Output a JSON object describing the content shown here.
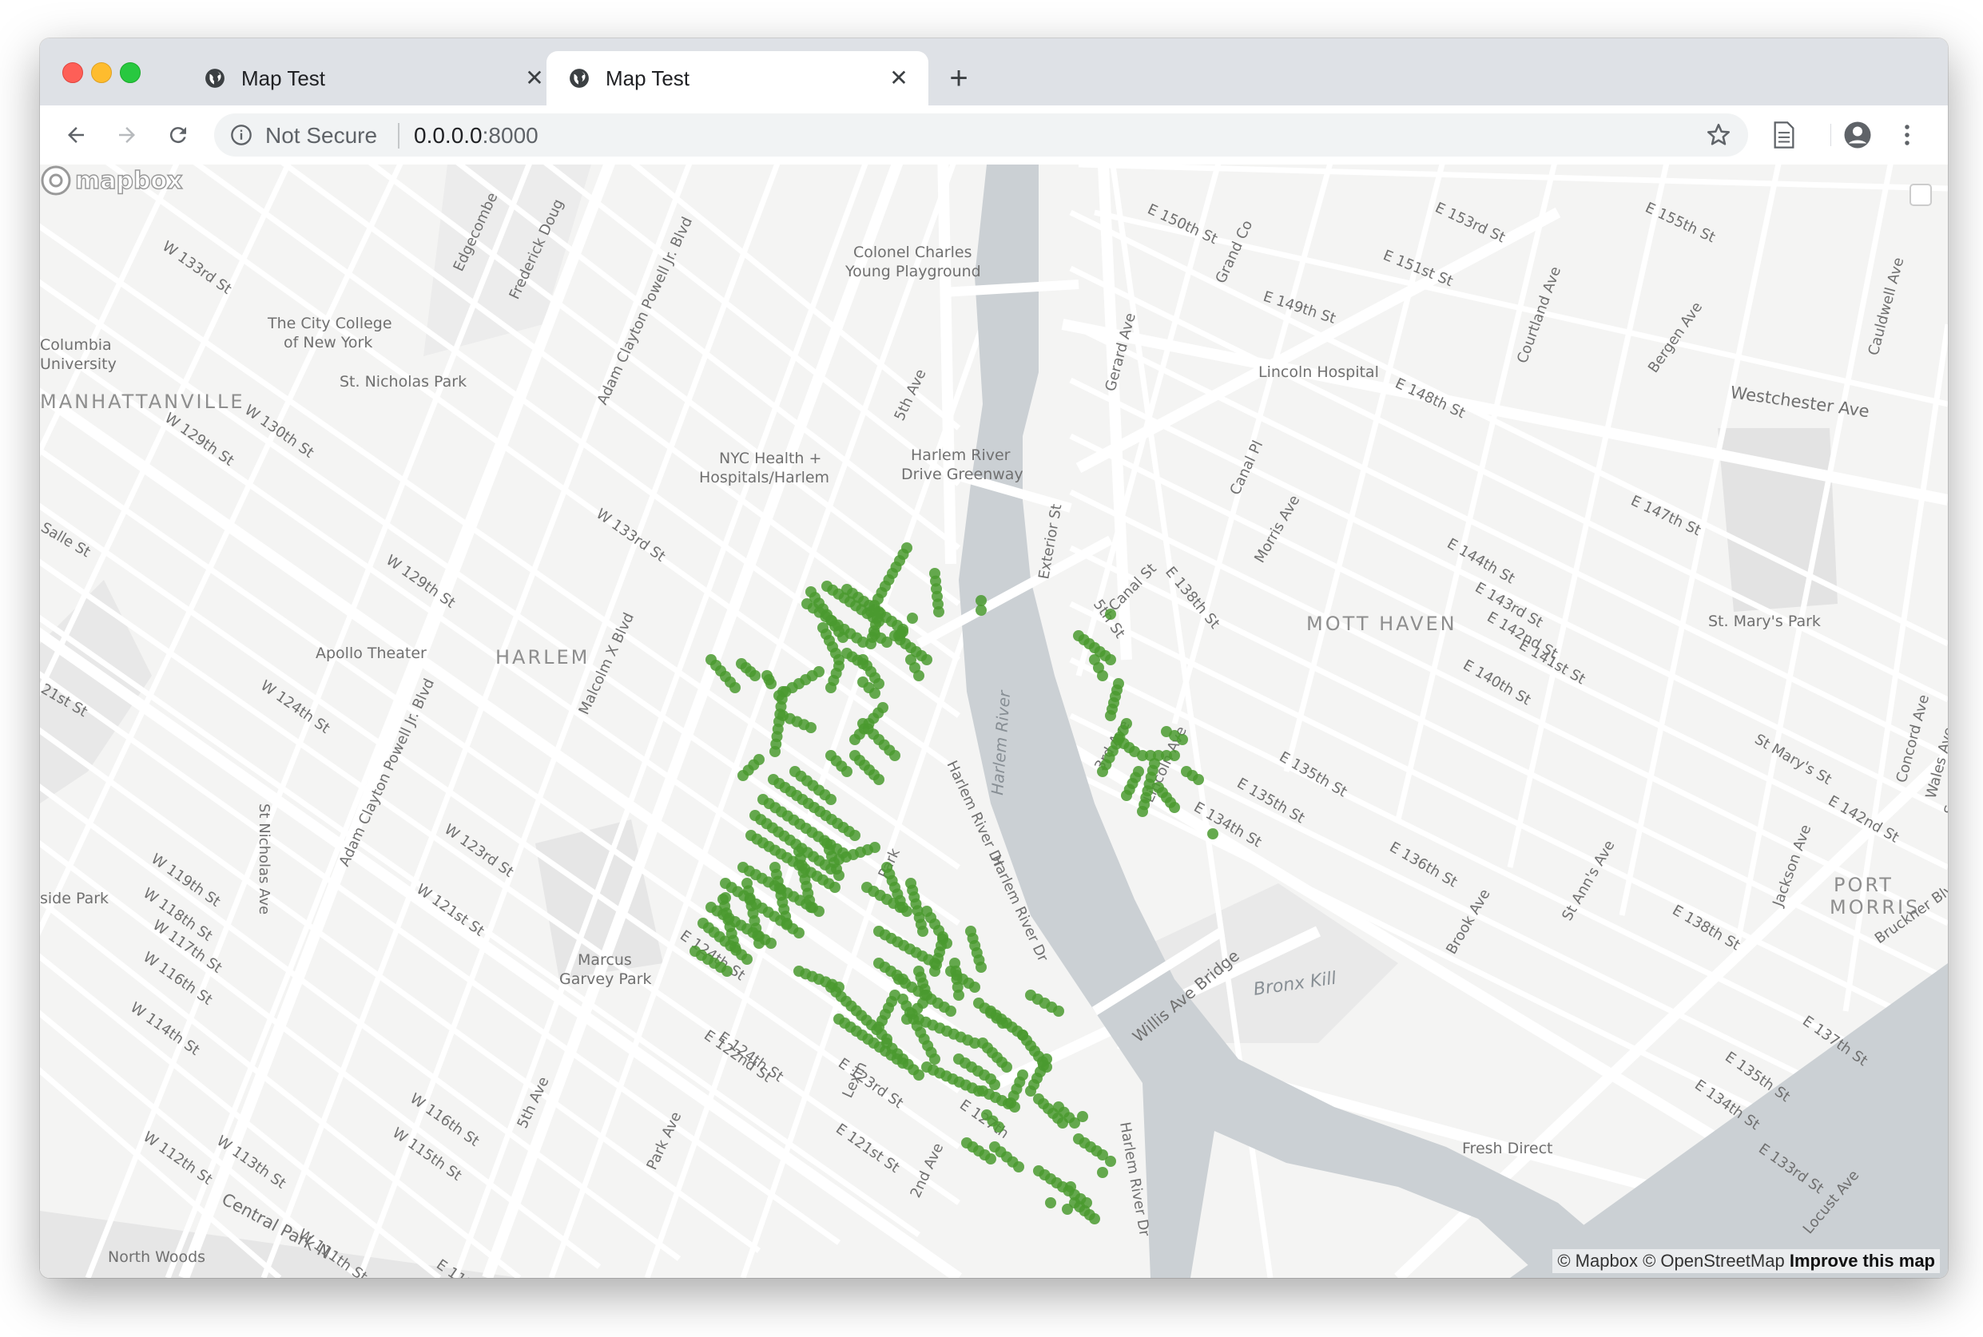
{
  "browser": {
    "tabs": [
      {
        "title": "Map Test",
        "active": false
      },
      {
        "title": "Map Test",
        "active": true
      }
    ],
    "new_tab_label": "+",
    "security_label": "Not Secure",
    "url_host": "0.0.0.0",
    "url_port": ":8000"
  },
  "map": {
    "attribution_mapbox": "© Mapbox",
    "attribution_osm": "© OpenStreetMap",
    "attribution_improve": "Improve this map",
    "logo_text": "mapbox",
    "point_color": "#4a9a2f",
    "area_labels": [
      "MANHATTANVILLE",
      "HARLEM",
      "MOTT HAVEN",
      "PORT",
      "MORRIS"
    ],
    "water_labels": [
      "Harlem River",
      "Bronx Kill"
    ],
    "place_labels": [
      "Columbia",
      "University",
      "The City College",
      "of New York",
      "St. Nicholas Park",
      "Colonel Charles",
      "Young Playground",
      "NYC Health +",
      "Hospitals/Harlem",
      "Harlem River",
      "Drive Greenway",
      "Lincoln Hospital",
      "Apollo Theater",
      "St. Mary's Park",
      "Marcus",
      "Garvey Park",
      "Fresh Direct",
      "side Park",
      "North Woods"
    ],
    "street_labels": [
      "W 133rd St",
      "Edgecombe",
      "Frederick Doug",
      "Adam Clayton Powell Jr. Blvd",
      "W 129th St",
      "W 130th St",
      "Salle St",
      "W 129th St",
      "W 133rd St",
      "5th Ave",
      "E 150th St",
      "Grand Co",
      "E 153rd St",
      "E 155th St",
      "E 151st St",
      "E 149th St",
      "Courtland Ave",
      "Gerard Ave",
      "E 148th St",
      "Bergen Ave",
      "Cauldwell Ave",
      "Westchester Ave",
      "Canal Pl",
      "Exterior St",
      "Morris Ave",
      "E 147th St",
      "E 144th St",
      "E 143rd St",
      "E 142nd St",
      "E 141st St",
      "E 140th St",
      "Canal St",
      "E 138th St",
      "W 124th St",
      "21st St",
      "Malcolm X Blvd",
      "Adam Clayton Powell Jr. Blvd",
      "W 123rd St",
      "W 121st St",
      "W 119th St",
      "W 118th St",
      "W 117th St",
      "W 116th St",
      "W 114th St",
      "St Nicholas Ave",
      "3rd Ave",
      "Lincoln Ave",
      "E 134th St",
      "E 135th St",
      "E 136th St",
      "Brook Ave",
      "St Ann's Ave",
      "E 138th St",
      "Jackson Ave",
      "St Mary's St",
      "Concord Ave",
      "Wales Ave",
      "E 142nd St",
      "Southern",
      "Bruckner Blvd",
      "E 124th St",
      "E 122nd St",
      "E 123rd St",
      "E 121st St",
      "2nd Ave",
      "Park Ave",
      "W 116th St",
      "W 115th St",
      "W 113th St",
      "W 112th St",
      "5th Ave",
      "W 111th St",
      "Central Park N",
      "E 112th",
      "Willis Ave Bridge",
      "Harlem River Dr",
      "Harlem River Dr",
      "E 137th St",
      "E 135th St",
      "E 134th St",
      "E 133rd St",
      "Locust Ave",
      "E 135th St",
      "E 127th",
      "Lexin",
      "Park",
      "Harlem River Dr",
      "5th St",
      "E 124th St"
    ]
  }
}
